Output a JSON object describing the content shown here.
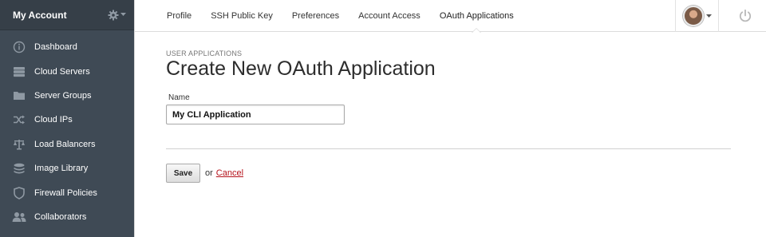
{
  "sidebar": {
    "title": "My Account",
    "settings_icon": "gear-icon",
    "items": [
      {
        "label": "Dashboard",
        "icon": "dashboard-icon"
      },
      {
        "label": "Cloud Servers",
        "icon": "server-icon"
      },
      {
        "label": "Server Groups",
        "icon": "folder-icon"
      },
      {
        "label": "Cloud IPs",
        "icon": "shuffle-icon"
      },
      {
        "label": "Load Balancers",
        "icon": "balance-icon"
      },
      {
        "label": "Image Library",
        "icon": "stack-icon"
      },
      {
        "label": "Firewall Policies",
        "icon": "shield-icon"
      },
      {
        "label": "Collaborators",
        "icon": "people-icon"
      }
    ]
  },
  "topbar": {
    "tabs": [
      {
        "label": "Profile",
        "active": false
      },
      {
        "label": "SSH Public Key",
        "active": false
      },
      {
        "label": "Preferences",
        "active": false
      },
      {
        "label": "Account Access",
        "active": false
      },
      {
        "label": "OAuth Applications",
        "active": true
      }
    ]
  },
  "main": {
    "section_label": "USER APPLICATIONS",
    "title": "Create New OAuth Application",
    "name_label": "Name",
    "name_value": "My CLI Application",
    "save_label": "Save",
    "or_text": "or",
    "cancel_label": "Cancel"
  },
  "colors": {
    "sidebar_bg": "#3f4a55",
    "link_red": "#b5121b"
  }
}
